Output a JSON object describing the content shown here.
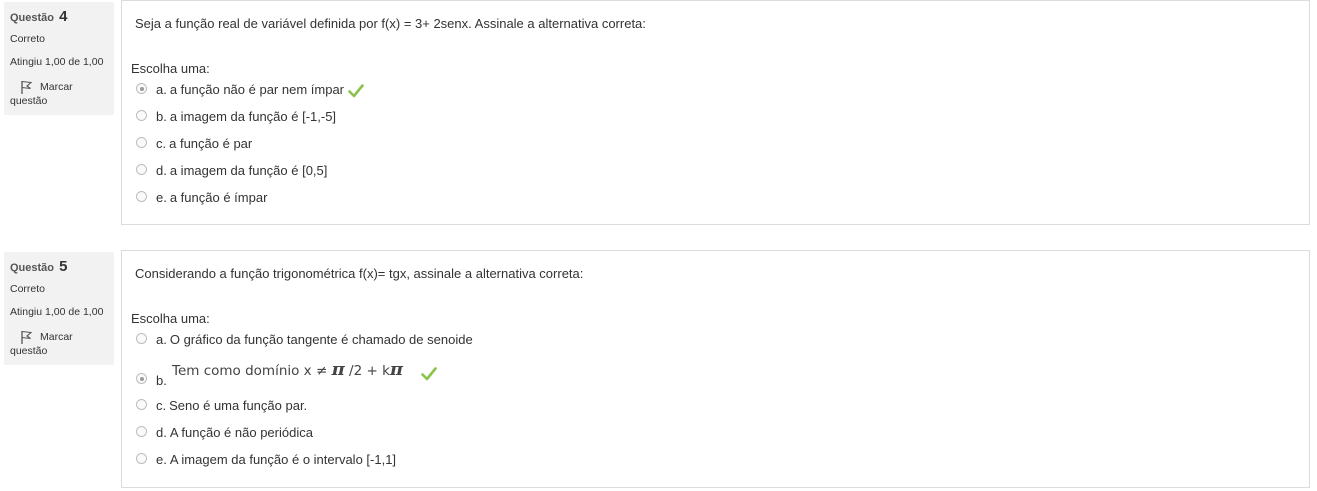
{
  "questions": [
    {
      "label": "Questão",
      "number": "4",
      "state": "Correto",
      "grade": "Atingiu 1,00 de 1,00",
      "flag_label_1": "Marcar",
      "flag_label_2": "questão",
      "text": "Seja a função real de variável definida por f(x) = 3+ 2senx. Assinale a alternativa correta:",
      "prompt": "Escolha uma:",
      "answers": [
        {
          "letter": "a.",
          "text": "a função não é par nem ímpar",
          "selected": true,
          "correct": true
        },
        {
          "letter": "b.",
          "text": "a imagem da função é [-1,-5]",
          "selected": false
        },
        {
          "letter": "c.",
          "text": "a função é par",
          "selected": false
        },
        {
          "letter": "d.",
          "text": "a imagem da função é [0,5]",
          "selected": false
        },
        {
          "letter": "e.",
          "text": "a função é ímpar",
          "selected": false
        }
      ]
    },
    {
      "label": "Questão",
      "number": "5",
      "state": "Correto",
      "grade": "Atingiu 1,00 de 1,00",
      "flag_label_1": "Marcar",
      "flag_label_2": "questão",
      "text": "Considerando a função trigonométrica f(x)= tgx, assinale a alternativa correta:",
      "prompt": "Escolha uma:",
      "answers": [
        {
          "letter": "a.",
          "text": "O gráfico da função tangente é chamado de senoide",
          "selected": false
        },
        {
          "letter": "b.",
          "text_part1": "Tem como domínio x ≠ ",
          "pi1": "π",
          "text_part2": " /2 + k",
          "pi2": "π",
          "selected": true,
          "correct": true
        },
        {
          "letter": "c.",
          "text": "Seno é uma função par.",
          "selected": false
        },
        {
          "letter": "d.",
          "text": "A função é não periódica",
          "selected": false
        },
        {
          "letter": "e.",
          "text": "A imagem da função é o intervalo [-1,1]",
          "selected": false
        }
      ]
    }
  ],
  "icons": {
    "flag": "flag-outline-icon",
    "correct": "green-checkmark-icon"
  },
  "colors": {
    "correct": "#8bc34a",
    "info_bg": "#f2f2f2",
    "border": "#dcdcdc"
  }
}
